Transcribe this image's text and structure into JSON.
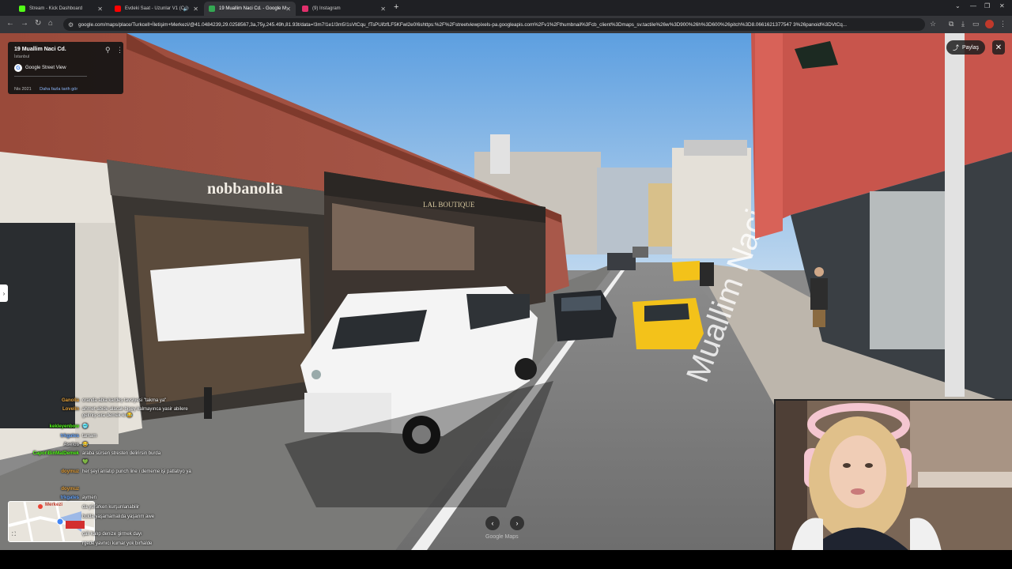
{
  "browser": {
    "tabs": [
      {
        "title": "Stream - Kick Dashboard",
        "favicon_color": "#53fc18",
        "active": false
      },
      {
        "title": "Evdeki Saat - Uzunlar V1 (C",
        "favicon_color": "#ff0000",
        "active": false,
        "muted": true
      },
      {
        "title": "19 Muallim Naci Cd. - Google M",
        "favicon_color": "#34a853",
        "active": true
      },
      {
        "title": "(9) Instagram",
        "favicon_color": "#e1306c",
        "active": false
      }
    ],
    "url": "google.com/maps/place/Turkcell+İletişim+Merkezi/@41.0484239,29.0258567,3a,75y,245.49h,81.93t/data=!3m7!1e1!3m5!1sVtCqu_fTsPUifzfLF5KFwl2e0!6shttps:%2F%2Fstreetviewpixels-pa.googleapis.com%2Fv1%2Fthumbnail%3Fcb_client%3Dmaps_sv.tactile%26w%3D900%26h%3D600%26pitch%3D8.0661621377547 3%26panoid%3DVtCq..."
  },
  "place_card": {
    "title": "19 Muallim Naci Cd.",
    "city": "İstanbul",
    "source": "Google Street View",
    "date": "Nis 2021",
    "history_link": "Daha fazla tarih gör"
  },
  "controls": {
    "share_label": "Paylaş",
    "close_glyph": "✕",
    "watermark": "Google Maps",
    "prev_glyph": "‹",
    "next_glyph": "›"
  },
  "scene_text": {
    "shop_sign": "nobbanolia",
    "boutique_sign": "LAL BOUTIQUE",
    "road_marking": "Muallim Naci"
  },
  "minimap": {
    "label": "Merkezi"
  },
  "chat": {
    "messages": [
      {
        "user": "Ganolia",
        "color": "#e8a33b",
        "text": "oranda abla kardeş tavsiyesi \"takma ya\""
      },
      {
        "user": "Lovelin",
        "color": "#e8a33b",
        "text": "ahmet abide alacak bişey kalmayınca yasir abilere gelmiş sıra demek ki 😂"
      },
      {
        "user": "kekleyenbow",
        "color": "#53fc18",
        "text": "🥶"
      },
      {
        "user": "trkgates",
        "color": "#6aa8ff",
        "text": "tamam"
      },
      {
        "user": "Aselos",
        "color": "#cccccc",
        "text": "😂"
      },
      {
        "user": "CaporiBinMalDemek",
        "color": "#53fc18",
        "text": "araba sürsen stresten delirirsin burda"
      },
      {
        "user": "",
        "color": "#ff4d4d",
        "text": "💚"
      },
      {
        "user": "doymuz",
        "color": "#e8a33b",
        "text": "her şeyi anlatıp punch line ı dememe işi patlatıyo ya"
      },
      {
        "user": "doymuz",
        "color": "#e8a33b",
        "text": ""
      },
      {
        "user": "trkgates",
        "color": "#6aa8ff",
        "text": "aymen"
      },
      {
        "user": "",
        "color": "#ff4d4d",
        "text": "da yürürken kurşunlanabilir"
      },
      {
        "user": "",
        "color": "#cccccc",
        "text": "bulda yaşamamalıda yaşarım awe"
      },
      {
        "user": "",
        "color": "#cccccc",
        "text": "çalı kalıp denize girmek dayı"
      },
      {
        "user": "",
        "color": "#cccccc",
        "text": "rgede yavnıcı kumar yok birhalde"
      }
    ]
  }
}
